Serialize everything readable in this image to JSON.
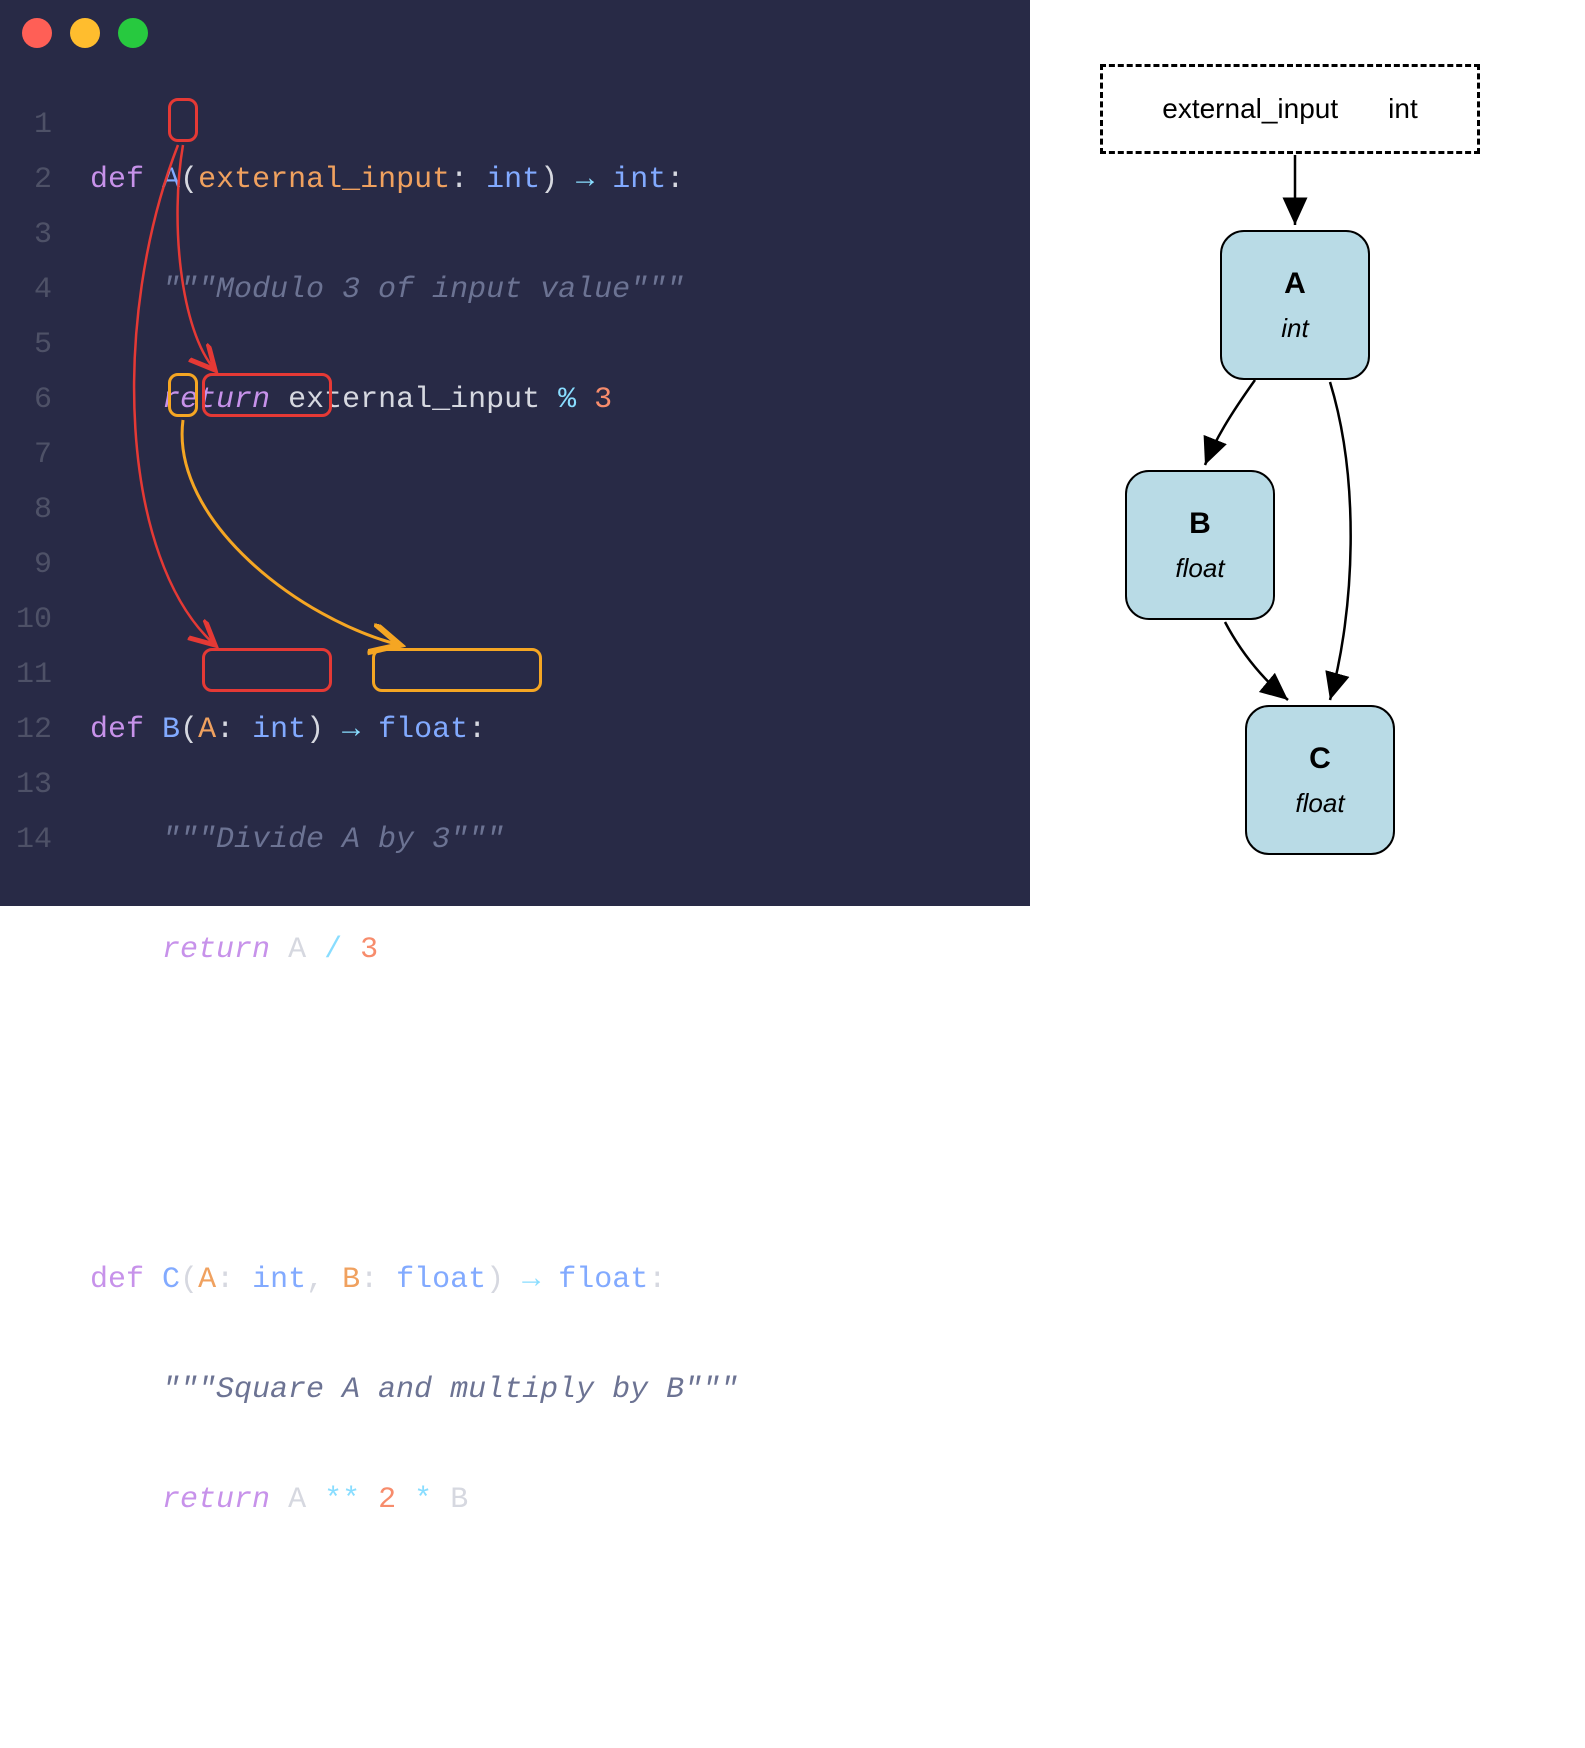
{
  "editor": {
    "line_numbers": [
      "1",
      "2",
      "3",
      "4",
      "5",
      "6",
      "7",
      "8",
      "9",
      "10",
      "11",
      "12",
      "13",
      "14"
    ],
    "funcA": {
      "def": "def",
      "name": "A",
      "param": "external_input",
      "param_type": "int",
      "ret_type": "int",
      "doc": "\"\"\"Modulo 3 of input value\"\"\"",
      "ret_kw": "return",
      "body": "external_input % 3"
    },
    "funcB": {
      "def": "def",
      "name": "B",
      "param": "A",
      "param_type": "int",
      "ret_type": "float",
      "doc": "\"\"\"Divide A by 3\"\"\"",
      "ret_kw": "return",
      "body": "A / 3"
    },
    "funcC": {
      "def": "def",
      "name": "C",
      "param1": "A",
      "param1_type": "int",
      "param2": "B",
      "param2_type": "float",
      "ret_type": "float",
      "doc": "\"\"\"Square A and multiply by B\"\"\"",
      "ret_kw": "return",
      "body": "A ** 2 * B"
    },
    "highlight_colors": {
      "red": "#e53935",
      "orange": "#f5a623"
    }
  },
  "diagram": {
    "input": {
      "label": "external_input",
      "type": "int"
    },
    "nodes": {
      "A": {
        "label": "A",
        "type": "int"
      },
      "B": {
        "label": "B",
        "type": "float"
      },
      "C": {
        "label": "C",
        "type": "float"
      }
    },
    "edges": [
      {
        "from": "input",
        "to": "A"
      },
      {
        "from": "A",
        "to": "B"
      },
      {
        "from": "A",
        "to": "C"
      },
      {
        "from": "B",
        "to": "C"
      }
    ]
  }
}
